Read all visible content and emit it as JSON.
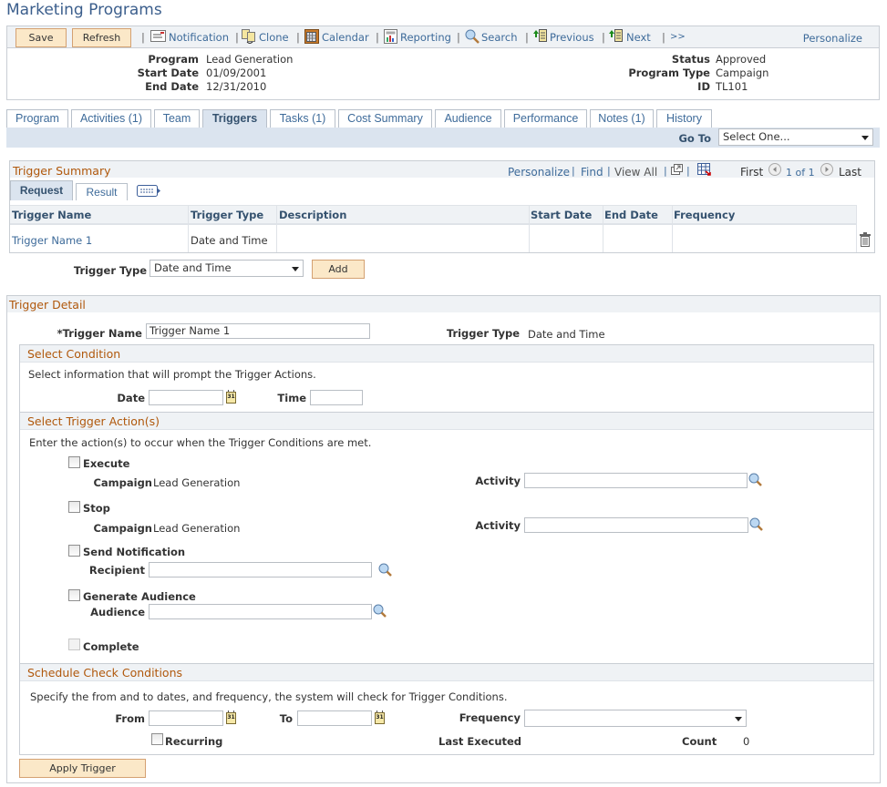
{
  "page": {
    "title": "Marketing Programs"
  },
  "toolbar": {
    "save_label": "Save",
    "refresh_label": "Refresh",
    "links": {
      "notification": "Notification",
      "clone": "Clone",
      "calendar": "Calendar",
      "reporting": "Reporting",
      "search": "Search",
      "previous": "Previous",
      "next": "Next",
      "more": ">>"
    },
    "personalize": "Personalize",
    "separator": "|"
  },
  "header": {
    "program_label": "Program",
    "program_value": "Lead Generation",
    "start_label": "Start Date",
    "start_value": "01/09/2001",
    "end_label": "End Date",
    "end_value": "12/31/2010",
    "status_label": "Status",
    "status_value": "Approved",
    "type_label": "Program Type",
    "type_value": "Campaign",
    "id_label": "ID",
    "id_value": "TL101"
  },
  "tabs": [
    {
      "label": "Program",
      "accesskey_index": 0
    },
    {
      "label": "Activities (1)"
    },
    {
      "label": "Team"
    },
    {
      "label": "Triggers",
      "active": true
    },
    {
      "label": "Tasks (1)"
    },
    {
      "label": "Cost Summary"
    },
    {
      "label": "Audience"
    },
    {
      "label": "Performance"
    },
    {
      "label": "Notes (1)"
    },
    {
      "label": "History"
    }
  ],
  "goto": {
    "label": "Go To",
    "value": "Select One..."
  },
  "trigger_summary": {
    "title": "Trigger Summary",
    "nav": {
      "personalize": "Personalize",
      "find": "Find",
      "view_all": "View All",
      "first": "First",
      "range": "1 of 1",
      "last": "Last",
      "sep": "|"
    },
    "subtabs": [
      {
        "label": "Request",
        "active": true
      },
      {
        "label": "Result"
      }
    ],
    "columns": [
      "Trigger Name",
      "Trigger Type",
      "Description",
      "Start Date",
      "End Date",
      "Frequency"
    ],
    "rows": [
      {
        "trigger_name": "Trigger Name 1",
        "trigger_type": "Date and Time",
        "description": "",
        "start_date": "",
        "end_date": "",
        "frequency": ""
      }
    ]
  },
  "add_trigger": {
    "label": "Trigger Type",
    "value": "Date and Time",
    "add_label": "Add"
  },
  "trigger_detail": {
    "title": "Trigger Detail",
    "name_label": "*Trigger Name",
    "name_value": "Trigger Name 1",
    "type_label": "Trigger Type",
    "type_value": "Date and Time",
    "select_condition": {
      "title": "Select Condition",
      "note": "Select information that will prompt the Trigger Actions.",
      "date_label": "Date",
      "date_value": "",
      "time_label": "Time",
      "time_value": ""
    },
    "actions": {
      "title": "Select Trigger Action(s)",
      "note": "Enter the action(s) to occur when the Trigger Conditions are met.",
      "execute": {
        "label": "Execute",
        "checked": false,
        "campaign_label": "Campaign",
        "campaign_value": "Lead Generation",
        "activity_label": "Activity",
        "activity_value": ""
      },
      "stop": {
        "label": "Stop",
        "checked": false,
        "campaign_label": "Campaign",
        "campaign_value": "Lead Generation",
        "activity_label": "Activity",
        "activity_value": ""
      },
      "send_notification": {
        "label": "Send Notification",
        "checked": false,
        "recipient_label": "Recipient",
        "recipient_value": ""
      },
      "generate_audience": {
        "label": "Generate Audience",
        "checked": false,
        "audience_label": "Audience",
        "audience_value": ""
      },
      "complete": {
        "label": "Complete",
        "checked": false,
        "disabled": true
      }
    },
    "schedule": {
      "title": "Schedule Check Conditions",
      "note": "Specify the from and to dates, and frequency, the system will check for Trigger Conditions.",
      "from_label": "From",
      "from_value": "",
      "to_label": "To",
      "to_value": "",
      "frequency_label": "Frequency",
      "frequency_value": "",
      "recurring_label": "Recurring",
      "recurring_checked": false,
      "last_executed_label": "Last Executed",
      "last_executed_value": "",
      "count_label": "Count",
      "count_value": "0"
    },
    "apply_label": "Apply Trigger"
  },
  "colors": {
    "link": "#3e6b9a",
    "section_title": "#b0580c",
    "button_bg": "#fbe8c8",
    "tab_active_bg": "#dbe4ef"
  }
}
